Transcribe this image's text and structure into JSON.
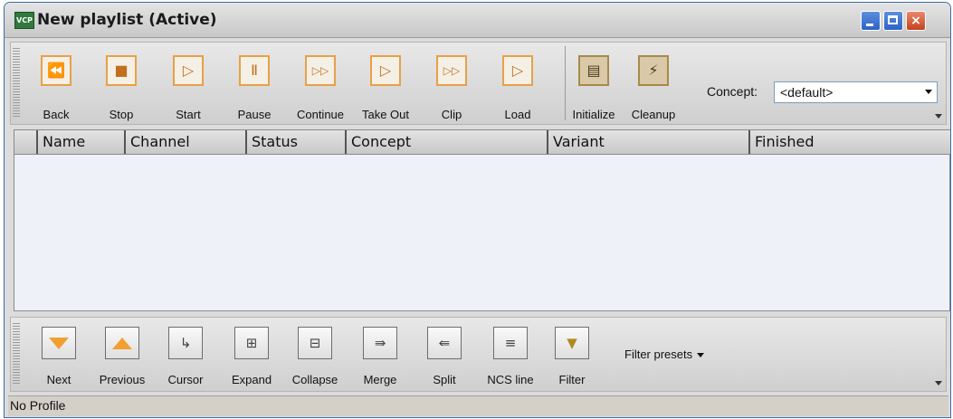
{
  "window": {
    "title": "New playlist (Active)",
    "app_icon_text": "VCP",
    "controls": {
      "minimize": "minimize",
      "maximize": "maximize",
      "close": "×"
    }
  },
  "toolbar": {
    "buttons": [
      {
        "label": "Back",
        "icon": "back-icon",
        "glyph": "⏪"
      },
      {
        "label": "Stop",
        "icon": "stop-icon",
        "glyph": "■"
      },
      {
        "label": "Start",
        "icon": "start-icon",
        "glyph": "▷"
      },
      {
        "label": "Pause",
        "icon": "pause-icon",
        "glyph": "Ⅱ"
      },
      {
        "label": "Continue",
        "icon": "continue-icon",
        "glyph": "▷▷"
      },
      {
        "label": "Take Out",
        "icon": "take-out-icon",
        "glyph": "▷"
      },
      {
        "label": "Clip",
        "icon": "clip-icon",
        "glyph": "▷▷"
      },
      {
        "label": "Load",
        "icon": "load-icon",
        "glyph": "▷"
      },
      {
        "label": "Initialize",
        "icon": "initialize-icon",
        "glyph": "▤"
      },
      {
        "label": "Cleanup",
        "icon": "cleanup-icon",
        "glyph": "⚡"
      }
    ],
    "concept_label": "Concept:",
    "concept_value": "<default>"
  },
  "table": {
    "columns": [
      "Name",
      "Channel",
      "Status",
      "Concept",
      "Variant",
      "Finished"
    ],
    "rows": []
  },
  "bottom_toolbar": {
    "buttons": [
      {
        "label": "Next",
        "icon": "arrow-down-icon"
      },
      {
        "label": "Previous",
        "icon": "arrow-up-icon"
      },
      {
        "label": "Cursor",
        "icon": "cursor-icon",
        "glyph": "↳"
      },
      {
        "label": "Expand",
        "icon": "expand-icon",
        "glyph": "⊞"
      },
      {
        "label": "Collapse",
        "icon": "collapse-icon",
        "glyph": "⊟"
      },
      {
        "label": "Merge",
        "icon": "merge-icon",
        "glyph": "⇛"
      },
      {
        "label": "Split",
        "icon": "split-icon",
        "glyph": "⇚"
      },
      {
        "label": "NCS line",
        "icon": "ncs-line-icon",
        "glyph": "≡"
      },
      {
        "label": "Filter",
        "icon": "filter-icon",
        "glyph": "▼"
      }
    ],
    "filter_presets": "Filter presets"
  },
  "status": {
    "text": "No Profile"
  }
}
